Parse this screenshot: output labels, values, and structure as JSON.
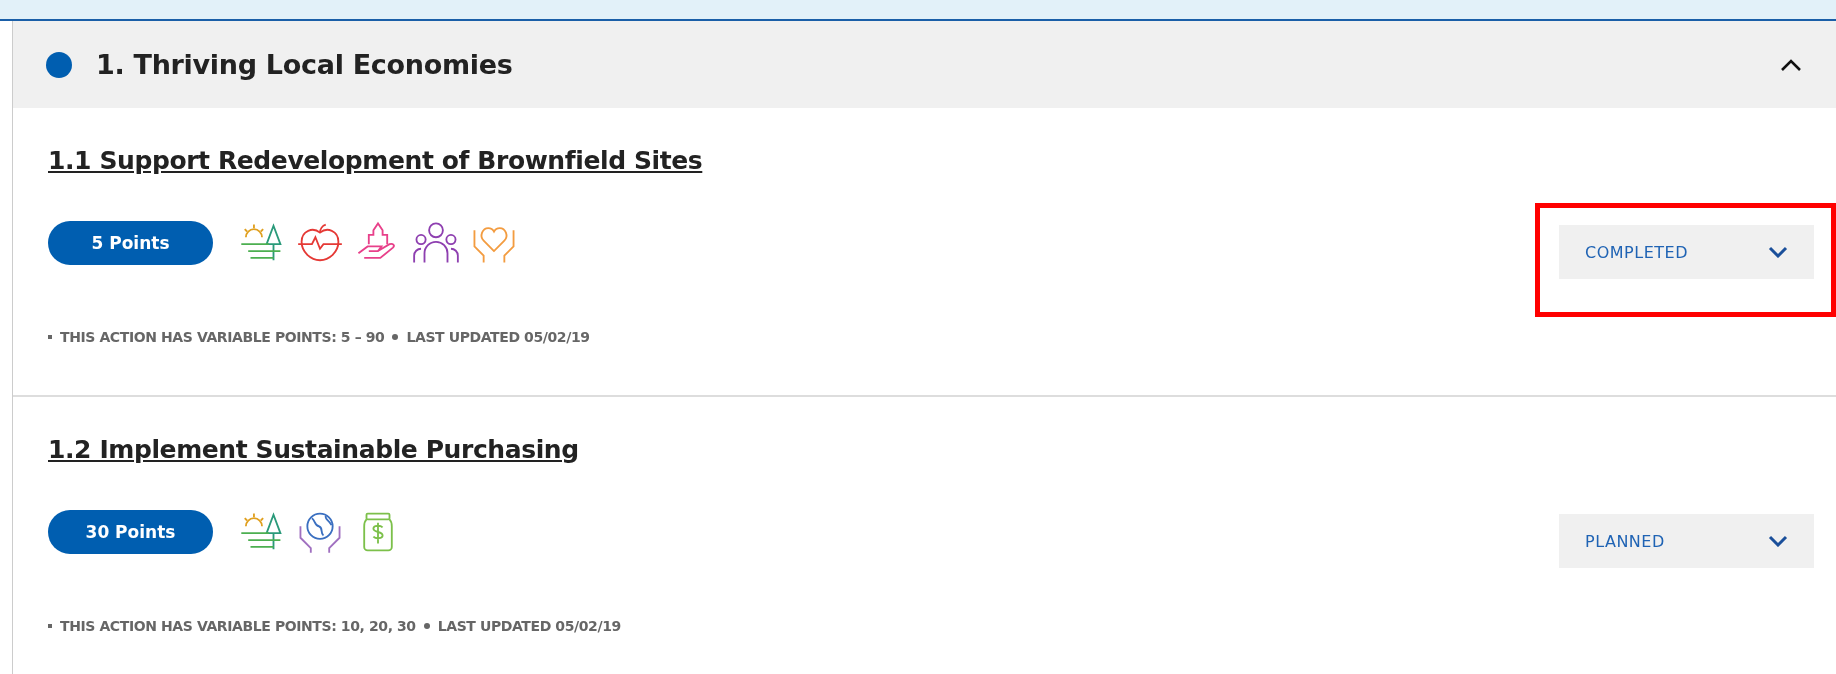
{
  "section": {
    "title": "1. Thriving Local Economies",
    "expanded": true,
    "actions": [
      {
        "title": "1.1 Support Redevelopment of Brownfield Sites",
        "points": "5 Points",
        "icons": [
          {
            "kind": "landscape"
          },
          {
            "kind": "health"
          },
          {
            "kind": "community"
          },
          {
            "kind": "people"
          },
          {
            "kind": "care"
          }
        ],
        "status": "COMPLETED",
        "highlighted": true,
        "variable_points": "THIS ACTION HAS VARIABLE POINTS: 5 – 90",
        "updated": "LAST UPDATED 05/02/19"
      },
      {
        "title": "1.2 Implement Sustainable Purchasing",
        "points": "30 Points",
        "icons": [
          {
            "kind": "landscape"
          },
          {
            "kind": "globe"
          },
          {
            "kind": "money"
          }
        ],
        "status": "PLANNED",
        "highlighted": false,
        "variable_points": "THIS ACTION HAS VARIABLE POINTS: 10, 20, 30",
        "updated": "LAST UPDATED 05/02/19"
      }
    ]
  }
}
